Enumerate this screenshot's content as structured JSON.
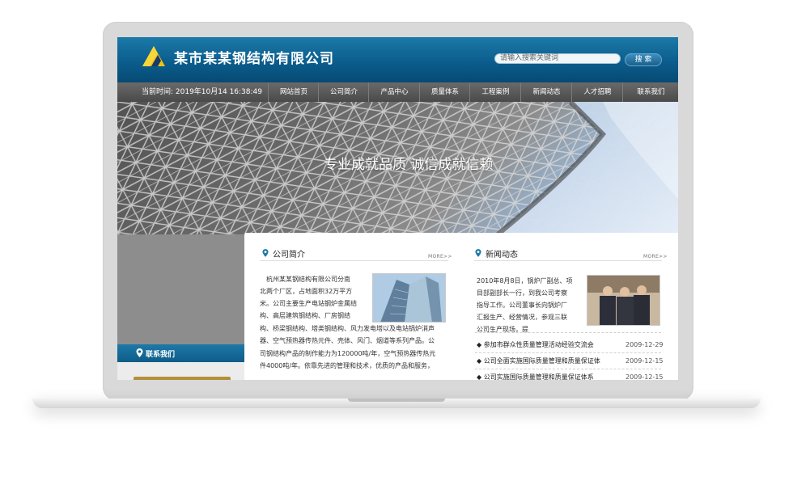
{
  "header": {
    "company_name": "某市某某钢结构有限公司",
    "search_placeholder": "请输入搜索关键词",
    "search_button": "搜 索"
  },
  "nav": {
    "current_time_label": "当前时间: 2019年10月14 16:38:49",
    "items": [
      "网站首页",
      "公司简介",
      "产品中心",
      "质量体系",
      "工程案例",
      "新闻动态",
      "人才招聘",
      "联系我们"
    ]
  },
  "banner": {
    "slogan": "专业成就品质 诚信成就信赖"
  },
  "about": {
    "title": "公司简介",
    "more": "MORE>>",
    "lines": [
      "杭州某某钢结构有限公司分南",
      "北两个厂区，占地面积32万平方",
      "米。公司主要生产电站钢炉金属结",
      "构、高层建筑钢结构、厂房钢结",
      "构、桥梁钢结构、塔类钢结构、风力发电塔以及电站锅炉消声",
      "器、空气预热器传热元件、壳体、风门、烟道等系列产品。公",
      "司钢结构产品的制作能力为120000吨/年，空气预热器传热元",
      "件4000吨/年。依靠先进的管理和技术，优质的产品和服务，"
    ]
  },
  "news": {
    "title": "新闻动态",
    "more": "MORE>>",
    "intro_lines": [
      "2010年8月8日，锅炉厂副总、项",
      "目部副部长一行，到我公司考察",
      "指导工作。公司董事长向锅炉厂",
      "汇报生产、经营情况，参观三联",
      "公司生产现场，提"
    ],
    "items": [
      {
        "title": "参加市群众性质量管理活动经验交流会",
        "date": "2009-12-29"
      },
      {
        "title": "公司全面实施国际质量管理和质量保证体",
        "date": "2009-12-15"
      },
      {
        "title": "公司实施国际质量管理和质量保证体系",
        "date": "2009-12-15"
      }
    ]
  },
  "contact": {
    "title": "联系我们"
  },
  "colors": {
    "header_blue": "#0b5d8d",
    "nav_gray": "#555555",
    "accent_gold": "#f1c20f"
  }
}
